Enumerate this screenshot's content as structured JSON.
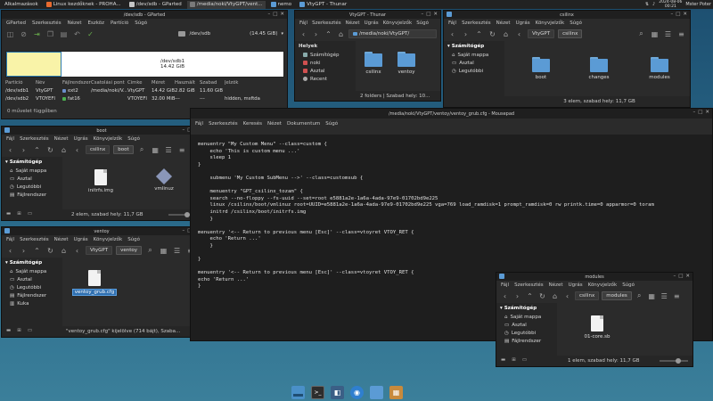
{
  "taskbar": {
    "apps_label": "Alkalmazások",
    "items": [
      "Linux kezdőknek - PROHA...",
      "/dev/sdb - GParted",
      "/media/noki/VtyGPT/vent...",
      "nemo",
      "VtyGPT - Thunar"
    ],
    "date": "2024-08-06",
    "time": "00:21",
    "user": "Mster Poter"
  },
  "gparted": {
    "title": "/dev/sdb - GParted",
    "menu": [
      "GParted",
      "Szerkesztés",
      "Nézet",
      "Eszköz",
      "Partíció",
      "Súgó"
    ],
    "device": "/dev/sdb",
    "device_size": "(14.45 GiB)",
    "disk_part": "/dev/sdb1",
    "disk_size": "14.42 GiB",
    "columns": [
      "Partíció",
      "Név",
      "Fájlrendszer",
      "Csatolási pont",
      "Címke",
      "Méret",
      "Használt",
      "Szabad",
      "Jelzők"
    ],
    "rows": [
      {
        "partition": "/dev/sdb1",
        "name": "VtyGPT",
        "fs": "ext2",
        "mount": "/media/noki/V...",
        "label": "VtyGPT",
        "size": "14.42 GiB",
        "used": "2.82 GiB",
        "free": "11.60 GiB",
        "flags": ""
      },
      {
        "partition": "/dev/sdb2",
        "name": "VTOYEFI",
        "fs": "fat16",
        "mount": "",
        "label": "VTOYEFI",
        "size": "32.00 MiB",
        "used": "---",
        "free": "---",
        "flags": "hidden, msftdata"
      }
    ],
    "status": "0 művelet függőben"
  },
  "thunar_vty": {
    "title": "VtyGPT - Thunar",
    "menu": [
      "Fájl",
      "Szerkesztés",
      "Nézet",
      "Ugrás",
      "Könyvjelzők",
      "Súgó"
    ],
    "path": "/media/noki/VtyGPT/",
    "side_header": "Helyek",
    "side_items": [
      "Számítógép",
      "noki",
      "Asztal",
      "Recent"
    ],
    "files": [
      "csilinx",
      "ventoy"
    ],
    "status": "2 folders | Szabad hely: 10..."
  },
  "nemo_csilinx": {
    "title": "csilinx",
    "menu": [
      "Fájl",
      "Szerkesztés",
      "Nézet",
      "Ugrás",
      "Könyvjelzők",
      "Súgó"
    ],
    "crumbs": [
      "VtyGPT",
      "csilinx"
    ],
    "side_header": "Számítógép",
    "side_items": [
      "Saját mappa",
      "Asztal",
      "Legutóbbi"
    ],
    "files": [
      "boot",
      "changes",
      "modules"
    ],
    "status": "3 elem, szabad hely: 11,7 GB"
  },
  "nemo_boot": {
    "title": "boot",
    "menu": [
      "Fájl",
      "Szerkesztés",
      "Nézet",
      "Ugrás",
      "Könyvjelzők",
      "Súgó"
    ],
    "crumbs": [
      "csilinx",
      "boot"
    ],
    "side_header": "Számítógép",
    "side_items": [
      "Saját mappa",
      "Asztal",
      "Legutóbbi",
      "Fájlrendszer"
    ],
    "files": [
      "initrfs.img",
      "vmlinuz"
    ],
    "status": "2 elem, szabad hely: 11,7 GB"
  },
  "nemo_ventoy": {
    "title": "ventoy",
    "menu": [
      "Fájl",
      "Szerkesztés",
      "Nézet",
      "Ugrás",
      "Könyvjelzők",
      "Súgó"
    ],
    "crumbs": [
      "VtyGPT",
      "ventoy"
    ],
    "side_header": "Számítógép",
    "side_items": [
      "Saját mappa",
      "Asztal",
      "Legutóbbi",
      "Fájlrendszer",
      "Kuka"
    ],
    "files": [
      "ventoy_grub.cfg"
    ],
    "status": "\"ventoy_grub.cfg\" kijelölve (714 bájt), Szaba..."
  },
  "mousepad": {
    "title": "/media/noki/VtyGPT/ventoy/ventoy_grub.cfg - Mousepad",
    "menu": [
      "Fájl",
      "Szerkesztés",
      "Keresés",
      "Nézet",
      "Dokumentum",
      "Súgó"
    ],
    "lines": [
      "menuentry \"My Custom Menu\" --class=custom {",
      "    echo 'This is custom menu ...'",
      "    sleep 1",
      "}",
      "",
      "    submenu 'My Custom SubMenu -->' --class=customsub {",
      "",
      "    menuentry \"GPT_csilinx_tozam\" {",
      "    search --no-floppy --fs-uuid --set=root e5881a2e-1a6a-4ada-97e9-01702bd9e225",
      "    linux /csilinx/boot/vmlinuz root=UUID=e5881a2e-1a6a-4ada-97e9-01702bd9e225 vga=769 load_ramdisk=1 prompt_ramdisk=0 rw printk.time=0 apparmor=0 toram",
      "    initrd /csilinx/boot/initrfs.img",
      "    }",
      "",
      "menuentry '<-- Return to previous menu [Esc]' --class=vtoyret VTOY_RET {",
      "    echo 'Return ...'",
      "    }",
      "",
      "}",
      "",
      "menuentry '<-- Return to previous menu [Esc]' --class=vtoyret VTOY_RET {",
      "echo 'Return ...'",
      "}"
    ]
  },
  "nemo_modules": {
    "title": "modules",
    "menu": [
      "Fájl",
      "Szerkesztés",
      "Nézet",
      "Ugrás",
      "Könyvjelzők",
      "Súgó"
    ],
    "crumbs": [
      "csilinx",
      "modules"
    ],
    "side_header": "Számítógép",
    "side_items": [
      "Saját mappa",
      "Asztal",
      "Legutóbbi",
      "Fájlrendszer"
    ],
    "files": [
      "01-core.sb"
    ],
    "status": "1 elem, szabad hely: 11,7 GB"
  }
}
